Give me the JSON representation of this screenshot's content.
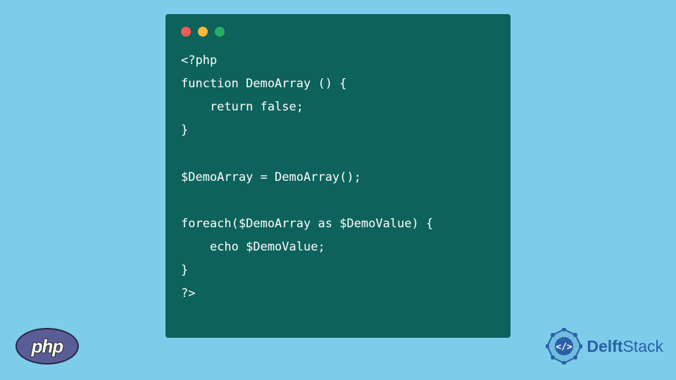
{
  "code": {
    "line1": "<?php",
    "line2": "function DemoArray () {",
    "line3": "    return false;",
    "line4": "}",
    "line5": "",
    "line6": "$DemoArray = DemoArray();",
    "line7": "",
    "line8": "foreach($DemoArray as $DemoValue) {",
    "line9": "    echo $DemoValue;",
    "line10": "}",
    "line11": "?>"
  },
  "logos": {
    "php": "php",
    "delft_bold": "Delft",
    "delft_rest": "Stack"
  }
}
